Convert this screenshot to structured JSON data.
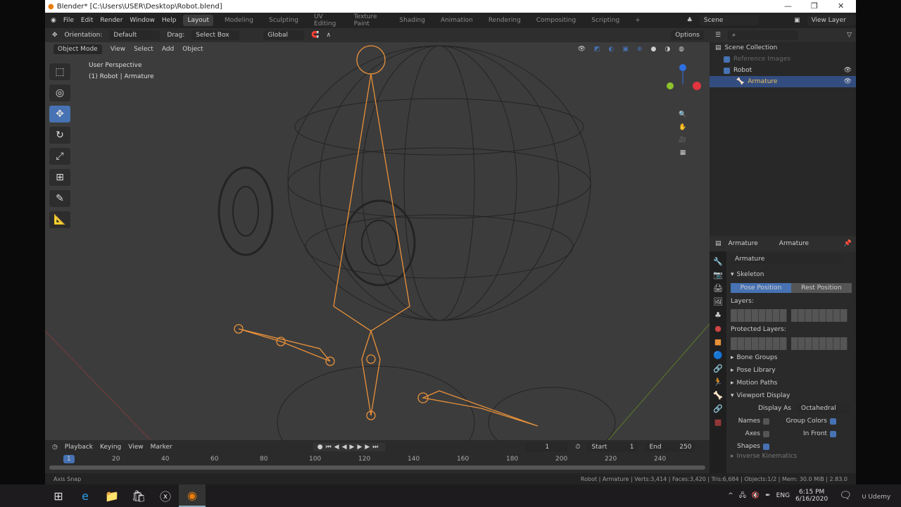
{
  "window": {
    "title": "Blender* [C:\\Users\\USER\\Desktop\\Robot.blend]"
  },
  "menu": [
    "File",
    "Edit",
    "Render",
    "Window",
    "Help"
  ],
  "workspaces": [
    "Layout",
    "Modeling",
    "Sculpting",
    "UV Editing",
    "Texture Paint",
    "Shading",
    "Animation",
    "Rendering",
    "Compositing",
    "Scripting",
    "+"
  ],
  "scene": "Scene",
  "view_layer": "View Layer",
  "toolheader": {
    "orientation_label": "Orientation:",
    "orientation": "Default",
    "drag_label": "Drag:",
    "drag": "Select Box",
    "transform": "Global",
    "options": "Options"
  },
  "viewport": {
    "mode": "Object Mode",
    "menus": [
      "View",
      "Select",
      "Add",
      "Object"
    ],
    "overlay_title": "User Perspective",
    "overlay_sub": "(1) Robot | Armature"
  },
  "outliner": {
    "items": [
      {
        "label": "Scene Collection"
      },
      {
        "label": "Reference Images"
      },
      {
        "label": "Robot"
      },
      {
        "label": "Armature"
      }
    ]
  },
  "properties": {
    "tab_object": "Armature",
    "tab_data": "Armature",
    "datablock": "Armature",
    "skeleton": "Skeleton",
    "pose_position": "Pose Position",
    "rest_position": "Rest Position",
    "layers": "Layers:",
    "protected_layers": "Protected Layers:",
    "panels": [
      "Bone Groups",
      "Pose Library",
      "Motion Paths",
      "Viewport Display"
    ],
    "display_as_label": "Display As",
    "display_as": "Octahedral",
    "names": "Names",
    "axes": "Axes",
    "shapes": "Shapes",
    "group_colors": "Group Colors",
    "in_front": "In Front",
    "next_panel": "Inverse Kinematics"
  },
  "timeline": {
    "menus": [
      "Playback",
      "Keying",
      "View",
      "Marker"
    ],
    "current_frame": "1",
    "start_label": "Start",
    "start": "1",
    "end_label": "End",
    "end": "250",
    "ticks": [
      "20",
      "40",
      "60",
      "80",
      "100",
      "120",
      "140",
      "160",
      "180",
      "200",
      "220",
      "240"
    ]
  },
  "status": {
    "left": "Axis Snap",
    "right": "Robot | Armature | Verts:3,414 | Faces:3,420 | Tris:6,684 | Objects:1/2 | Mem: 30.0 MiB | 2.83.0"
  },
  "taskbar": {
    "lang": "ENG",
    "time": "6:15 PM",
    "date": "6/16/2020",
    "watermark": "Udemy"
  },
  "colors": {
    "accent": "#4772b3",
    "bone": "#e8913a"
  }
}
